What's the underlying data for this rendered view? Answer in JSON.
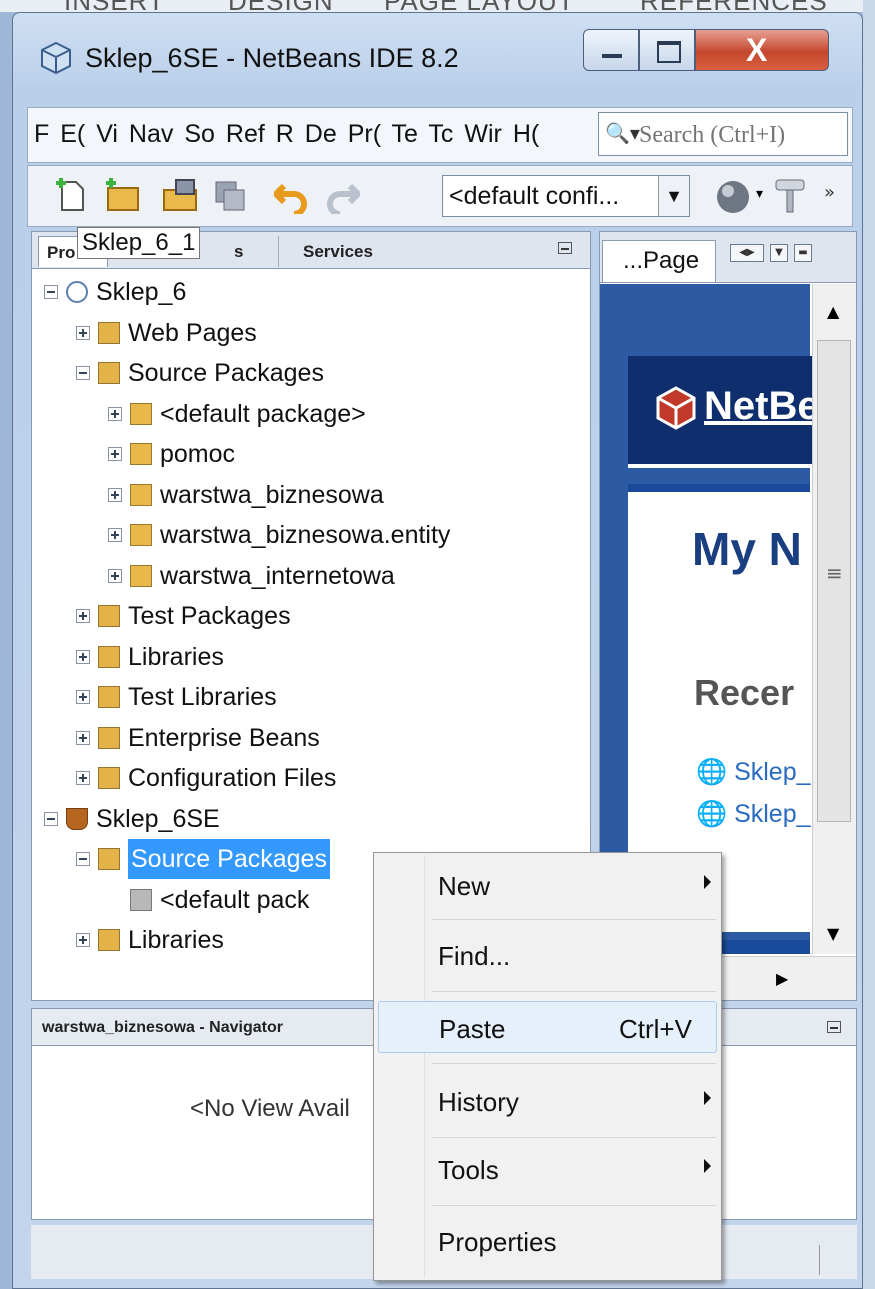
{
  "background": {
    "ribbon_tabs": [
      "INSERT",
      "DESIGN",
      "PAGE LAYOUT",
      "REFERENCES"
    ]
  },
  "window": {
    "title": "Sklep_6SE - NetBeans IDE 8.2",
    "close_glyph": "X"
  },
  "menubar": {
    "items": [
      "F",
      "E(",
      "Vi",
      "Nav",
      "So",
      "Ref",
      "R",
      "De",
      "Pr(",
      "Te",
      "Tc",
      "Wir",
      "H("
    ],
    "search_placeholder": "Search (Ctrl+I)"
  },
  "toolbar": {
    "config_value": "<default confi...",
    "icons": [
      "new-file-icon",
      "new-project-icon",
      "open-project-icon",
      "save-all-icon",
      "undo-icon",
      "redo-icon",
      "run-globe-icon",
      "build-hammer-icon"
    ]
  },
  "projects_panel": {
    "tabs": [
      "Pro",
      "s",
      "Services"
    ],
    "tooltip": "Sklep_6_1",
    "tree": [
      {
        "label": "Sklep_6",
        "depth": 0,
        "expanded": true,
        "icon": "web-project-icon"
      },
      {
        "label": "Web Pages",
        "depth": 1,
        "expanded": false,
        "icon": "web-folder-icon"
      },
      {
        "label": "Source Packages",
        "depth": 1,
        "expanded": true,
        "icon": "source-folder-icon"
      },
      {
        "label": "<default package>",
        "depth": 2,
        "expanded": false,
        "icon": "package-icon"
      },
      {
        "label": "pomoc",
        "depth": 2,
        "expanded": false,
        "icon": "package-icon"
      },
      {
        "label": "warstwa_biznesowa",
        "depth": 2,
        "expanded": false,
        "icon": "package-icon"
      },
      {
        "label": "warstwa_biznesowa.entity",
        "depth": 2,
        "expanded": false,
        "icon": "package-icon"
      },
      {
        "label": "warstwa_internetowa",
        "depth": 2,
        "expanded": false,
        "icon": "package-icon"
      },
      {
        "label": "Test Packages",
        "depth": 1,
        "expanded": false,
        "icon": "test-folder-icon"
      },
      {
        "label": "Libraries",
        "depth": 1,
        "expanded": false,
        "icon": "library-folder-icon"
      },
      {
        "label": "Test Libraries",
        "depth": 1,
        "expanded": false,
        "icon": "library-folder-icon"
      },
      {
        "label": "Enterprise Beans",
        "depth": 1,
        "expanded": false,
        "icon": "beans-folder-icon"
      },
      {
        "label": "Configuration Files",
        "depth": 1,
        "expanded": false,
        "icon": "config-folder-icon"
      },
      {
        "label": "Sklep_6SE",
        "depth": 0,
        "expanded": true,
        "icon": "java-project-icon"
      },
      {
        "label": "Source Packages",
        "depth": 1,
        "expanded": true,
        "icon": "source-folder-icon",
        "selected": true
      },
      {
        "label": "<default pack",
        "depth": 2,
        "expanded": null,
        "icon": "empty-package-icon"
      },
      {
        "label": "Libraries",
        "depth": 1,
        "expanded": false,
        "icon": "library-folder-icon"
      }
    ]
  },
  "navigator": {
    "title": "warstwa_biznesowa - Navigator",
    "empty_text": "<No View Avail"
  },
  "start_page": {
    "tab_label": "...Page",
    "logo_text": "NetBe",
    "heading": "My N",
    "recent_heading": "Recer",
    "recent_links": [
      "Sklep_",
      "Sklep_"
    ]
  },
  "context_menu": {
    "items": [
      {
        "label": "New",
        "shortcut": "",
        "submenu": true,
        "highlighted": false
      },
      {
        "label": "Find...",
        "shortcut": "",
        "submenu": false,
        "highlighted": false
      },
      {
        "label": "Paste",
        "shortcut": "Ctrl+V",
        "submenu": false,
        "highlighted": true
      },
      {
        "label": "History",
        "shortcut": "",
        "submenu": true,
        "highlighted": false
      },
      {
        "label": "Tools",
        "shortcut": "",
        "submenu": true,
        "highlighted": false
      },
      {
        "label": "Properties",
        "shortcut": "",
        "submenu": false,
        "highlighted": false
      }
    ]
  }
}
